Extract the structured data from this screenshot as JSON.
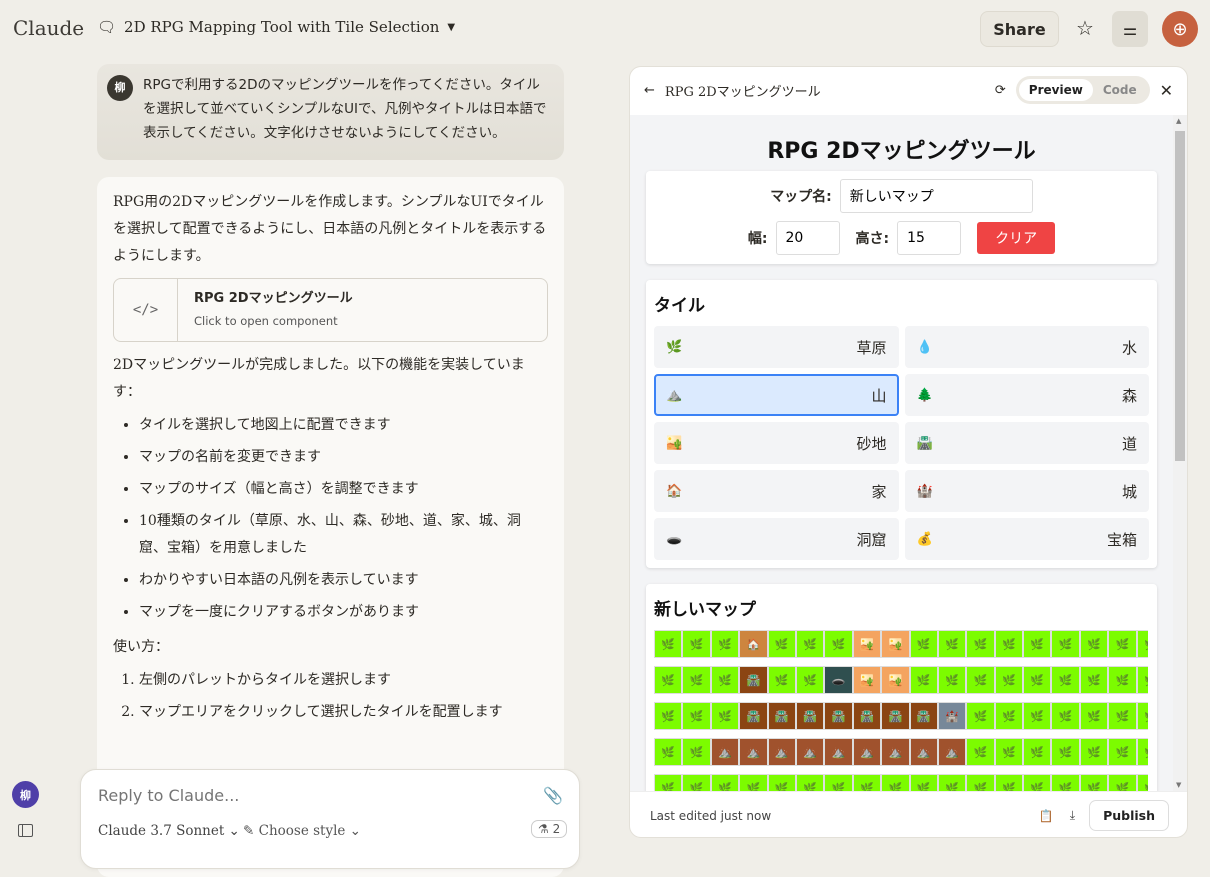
{
  "header": {
    "logo": "Claude",
    "chat_title": "2D RPG Mapping Tool with Tile Selection",
    "share": "Share"
  },
  "user_message": {
    "avatar": "柳",
    "text": "RPGで利用する2Dのマッピングツールを作ってください。タイルを選択して並べていくシンプルなUIで、凡例やタイトルは日本語で表示してください。文字化けさせないようにしてください。"
  },
  "reply": {
    "intro": "RPG用の2Dマッピングツールを作成します。シンプルなUIでタイルを選択して配置できるようにし、日本語の凡例とタイトルを表示するようにします。",
    "artifact_title": "RPG 2Dマッピングツール",
    "artifact_sub": "Click to open component",
    "done": "2Dマッピングツールが完成しました。以下の機能を実装しています：",
    "features": [
      "タイルを選択して地図上に配置できます",
      "マップの名前を変更できます",
      "マップのサイズ（幅と高さ）を調整できます",
      "10種類のタイル（草原、水、山、森、砂地、道、家、城、洞窟、宝箱）を用意しました",
      "わかりやすい日本語の凡例を表示しています",
      "マップを一度にクリアするボタンがあります"
    ],
    "usage": "使い方：",
    "steps": [
      "左側のパレットからタイルを選択します",
      "マップエリアをクリックして選択したタイルを配置します"
    ]
  },
  "composer": {
    "placeholder": "Reply to Claude...",
    "model": "Claude 3.7 Sonnet",
    "style": "Choose style",
    "count": "2"
  },
  "sidebar": {
    "avatar": "柳"
  },
  "panel": {
    "title": "RPG 2Dマッピングツール",
    "preview": "Preview",
    "code": "Code",
    "last_edited": "Last edited just now",
    "publish": "Publish"
  },
  "app": {
    "title": "RPG 2Dマッピングツール",
    "map_name_label": "マップ名:",
    "map_name": "新しいマップ",
    "width_label": "幅:",
    "width": "20",
    "height_label": "高さ:",
    "height": "15",
    "clear": "クリア",
    "tiles_heading": "タイル",
    "tiles": [
      {
        "key": "grass",
        "label": "草原",
        "emoji": "🌿",
        "color": "#7CFC00"
      },
      {
        "key": "water",
        "label": "水",
        "emoji": "💧",
        "color": "#1E90FF"
      },
      {
        "key": "mountain",
        "label": "山",
        "emoji": "⛰️",
        "color": "#A0522D"
      },
      {
        "key": "forest",
        "label": "森",
        "emoji": "🌲",
        "color": "#228B22"
      },
      {
        "key": "sand",
        "label": "砂地",
        "emoji": "🏜️",
        "color": "#F4A460"
      },
      {
        "key": "road",
        "label": "道",
        "emoji": "🛣️",
        "color": "#8B4513"
      },
      {
        "key": "house",
        "label": "家",
        "emoji": "🏠",
        "color": "#CD853F"
      },
      {
        "key": "castle",
        "label": "城",
        "emoji": "🏰",
        "color": "#778899"
      },
      {
        "key": "cave",
        "label": "洞窟",
        "emoji": "🕳️",
        "color": "#2F4F4F"
      },
      {
        "key": "treasure",
        "label": "宝箱",
        "emoji": "💰",
        "color": "#FFD700"
      }
    ],
    "selected_tile": "mountain",
    "map": [
      [
        "grass",
        "grass",
        "grass",
        "house",
        "grass",
        "grass",
        "grass",
        "sand",
        "sand",
        "grass",
        "grass",
        "grass",
        "grass",
        "grass",
        "grass",
        "grass",
        "grass",
        "grass",
        "grass",
        "grass"
      ],
      [
        "grass",
        "grass",
        "grass",
        "road",
        "grass",
        "grass",
        "cave",
        "sand",
        "sand",
        "grass",
        "grass",
        "grass",
        "grass",
        "grass",
        "grass",
        "grass",
        "grass",
        "grass",
        "grass",
        "grass"
      ],
      [
        "grass",
        "grass",
        "grass",
        "road",
        "road",
        "road",
        "road",
        "road",
        "road",
        "road",
        "castle",
        "grass",
        "grass",
        "grass",
        "grass",
        "grass",
        "grass",
        "grass",
        "grass",
        "grass"
      ],
      [
        "grass",
        "grass",
        "mountain",
        "mountain",
        "mountain",
        "mountain",
        "mountain",
        "mountain",
        "mountain",
        "mountain",
        "mountain",
        "grass",
        "grass",
        "grass",
        "grass",
        "grass",
        "grass",
        "grass",
        "grass",
        "grass"
      ],
      [
        "grass",
        "grass",
        "grass",
        "grass",
        "grass",
        "grass",
        "grass",
        "grass",
        "grass",
        "grass",
        "grass",
        "grass",
        "grass",
        "grass",
        "grass",
        "grass",
        "grass",
        "grass",
        "grass",
        "grass"
      ]
    ]
  }
}
